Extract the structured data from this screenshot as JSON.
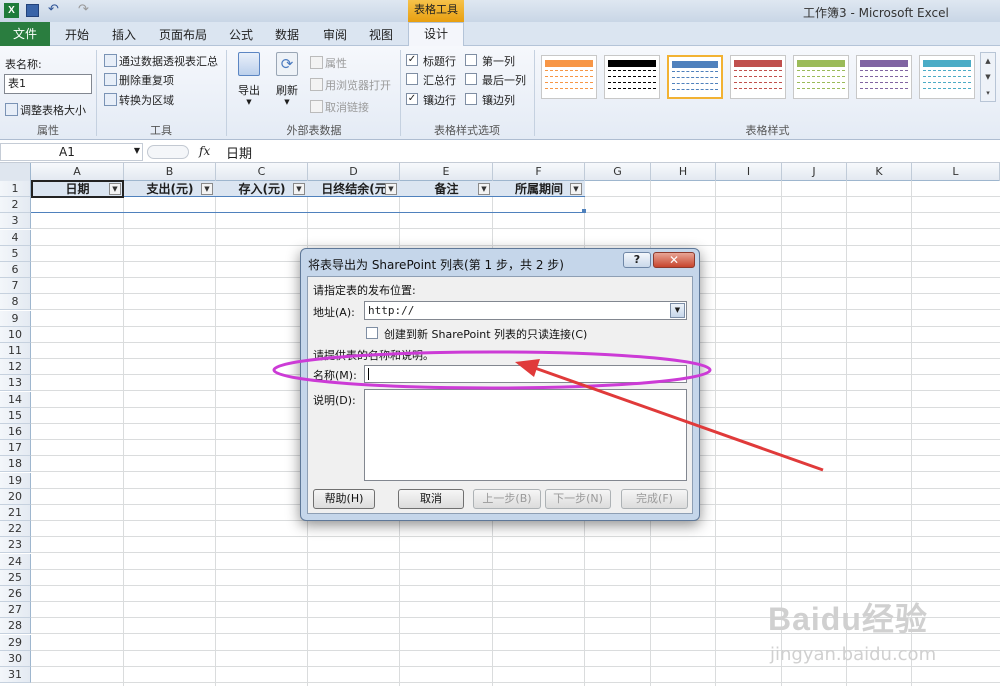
{
  "window": {
    "title": "工作簿3 - Microsoft Excel",
    "context_group": "表格工具"
  },
  "tabs": [
    "文件",
    "开始",
    "插入",
    "页面布局",
    "公式",
    "数据",
    "审阅",
    "视图",
    "设计"
  ],
  "ribbon": {
    "props": {
      "name_label": "表名称:",
      "name_value": "表1",
      "resize": "调整表格大小",
      "group": "属性"
    },
    "tools": {
      "pivot": "通过数据透视表汇总",
      "dedupe": "删除重复项",
      "convert": "转换为区域",
      "group": "工具"
    },
    "external": {
      "export": "导出",
      "refresh": "刷新",
      "properties": "属性",
      "open_browser": "用浏览器打开",
      "unlink": "取消链接",
      "group": "外部表数据"
    },
    "options": {
      "header_row": "标题行",
      "total_row": "汇总行",
      "banded_rows": "镶边行",
      "first_col": "第一列",
      "last_col": "最后一列",
      "banded_cols": "镶边列",
      "group": "表格样式选项",
      "checked": {
        "header_row": true,
        "total_row": false,
        "banded_rows": true,
        "first_col": false,
        "last_col": false,
        "banded_cols": false
      }
    },
    "styles": {
      "group": "表格样式",
      "colors": [
        "#f79646",
        "#000000",
        "#4f81bd",
        "#c0504d",
        "#9bbb59",
        "#8064a2",
        "#4bacc6"
      ]
    }
  },
  "formula_bar": {
    "name_box": "A1",
    "fx": "fx",
    "content": "日期"
  },
  "columns": [
    "A",
    "B",
    "C",
    "D",
    "E",
    "F",
    "G",
    "H",
    "I",
    "J",
    "K",
    "L"
  ],
  "rows": [
    "1",
    "2",
    "3",
    "4",
    "5",
    "6",
    "7",
    "8",
    "9",
    "10",
    "11",
    "12",
    "13",
    "14",
    "15",
    "16",
    "17",
    "18",
    "19",
    "20",
    "21",
    "22",
    "23",
    "24",
    "25",
    "26",
    "27",
    "28",
    "29",
    "30",
    "31"
  ],
  "table_headers": [
    "日期",
    "支出(元)",
    "存入(元)",
    "日终结余(元",
    "备注",
    "所属期间"
  ],
  "dialog": {
    "title": "将表导出为 SharePoint 列表(第 1 步，共 2 步)",
    "help_icon": "?",
    "section1": "请指定表的发布位置:",
    "address_label": "地址(A):",
    "address_value": "http://",
    "readonly_link": "创建到新 SharePoint 列表的只读连接(C)",
    "section2": "请提供表的名称和说明。",
    "name_label": "名称(M):",
    "name_value": "",
    "desc_label": "说明(D):",
    "desc_value": "",
    "buttons": {
      "help": "帮助(H)",
      "cancel": "取消",
      "prev": "上一步(B)",
      "next": "下一步(N)",
      "finish": "完成(F)"
    }
  },
  "watermark": {
    "brand": "Baidu经验",
    "url": "jingyan.baidu.com"
  },
  "annotation_colors": {
    "ellipse": "#cc3bd6",
    "arrow": "#e03a3a"
  }
}
